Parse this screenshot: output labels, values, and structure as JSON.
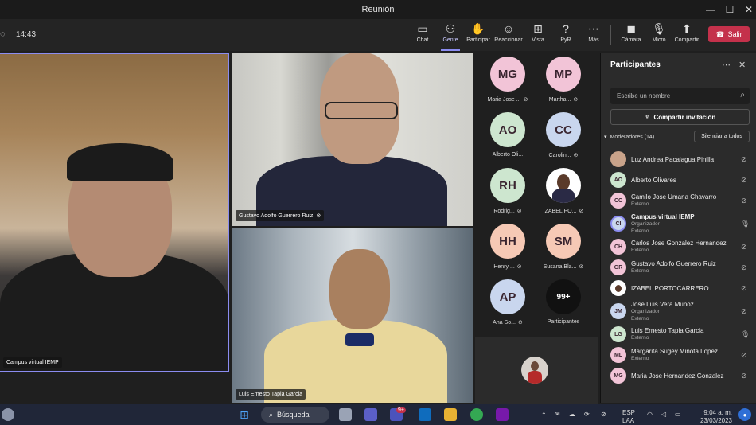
{
  "window": {
    "title": "Reunión",
    "minimize": "—",
    "maximize": "☐",
    "close": "✕"
  },
  "toolbar": {
    "time": "14:43",
    "buttons": [
      {
        "label": "Chat",
        "icon": "chat-icon"
      },
      {
        "label": "Gente",
        "icon": "people-icon"
      },
      {
        "label": "Participar",
        "icon": "hand-icon"
      },
      {
        "label": "Reaccionar",
        "icon": "emoji-icon"
      },
      {
        "label": "Vista",
        "icon": "view-icon"
      },
      {
        "label": "PyR",
        "icon": "qa-icon"
      },
      {
        "label": "Más",
        "icon": "more-icon"
      },
      {
        "label": "Cámara",
        "icon": "camera-off-icon"
      },
      {
        "label": "Micro",
        "icon": "mic-off-icon"
      },
      {
        "label": "Compartir",
        "icon": "share-icon"
      }
    ],
    "leave_label": "Salir"
  },
  "videos": [
    {
      "name": "Campus virtual IEMP"
    },
    {
      "name": "Gustavo Adolfo Guerrero Ruiz"
    },
    {
      "name": "Luis Ernesto Tapia Garcia"
    }
  ],
  "grid": [
    {
      "initials": "MG",
      "name": "Maria Jose ...",
      "color": "#f2c4d7"
    },
    {
      "initials": "MP",
      "name": "Martha...",
      "color": "#f2c4d7"
    },
    {
      "initials": "AO",
      "name": "Alberto Oli...",
      "color": "#cde6cf"
    },
    {
      "initials": "CC",
      "name": "Carolin...",
      "color": "#c9d6ee"
    },
    {
      "initials": "RH",
      "name": "Rodrig...",
      "color": "#cde6cf"
    },
    {
      "initials": "",
      "name": "IZABEL PO...",
      "color": "#ffffff"
    },
    {
      "initials": "HH",
      "name": "Henry ...",
      "color": "#f6c9b5"
    },
    {
      "initials": "SM",
      "name": "Susana Bla...",
      "color": "#f6c9b5"
    },
    {
      "initials": "AP",
      "name": "Ana So...",
      "color": "#c9d6ee"
    },
    {
      "initials": "99+",
      "name": "Participantes",
      "color": "#111111"
    }
  ],
  "panel": {
    "title": "Participantes",
    "search_placeholder": "Escribe un nombre",
    "share_invite": "Compartir invitación",
    "moderators_header": "Moderadores (14)",
    "mute_all": "Silenciar a todos",
    "people": [
      {
        "initials": "",
        "name": "Luz Andrea Pacalagua Pinilla",
        "sub": "",
        "color": "#c9a38a",
        "bold": false,
        "mic": "off"
      },
      {
        "initials": "AO",
        "name": "Alberto Olivares",
        "sub": "",
        "color": "#cde6cf",
        "bold": false,
        "mic": "off"
      },
      {
        "initials": "CC",
        "name": "Camilo Jose Umana Chavarro",
        "sub": "Externo",
        "color": "#f2c4d7",
        "bold": false,
        "mic": "off"
      },
      {
        "initials": "CI",
        "name": "Campus virtual IEMP",
        "sub": "Organizador\nExterno",
        "color": "#c9d6ee",
        "bold": true,
        "mic": "on"
      },
      {
        "initials": "CH",
        "name": "Carlos Jose Gonzalez Hernandez",
        "sub": "Externo",
        "color": "#f2c4d7",
        "bold": false,
        "mic": "off"
      },
      {
        "initials": "GR",
        "name": "Gustavo Adolfo Guerrero Ruiz",
        "sub": "Externo",
        "color": "#f2c4d7",
        "bold": false,
        "mic": "off"
      },
      {
        "initials": "",
        "name": "IZABEL PORTOCARRERO",
        "sub": "",
        "color": "#ffffff",
        "bold": false,
        "mic": "off"
      },
      {
        "initials": "JM",
        "name": "Jose Luis Vera Munoz",
        "sub": "Organizador\nExterno",
        "color": "#c9d6ee",
        "bold": false,
        "mic": "off"
      },
      {
        "initials": "LG",
        "name": "Luis Ernesto Tapia Garcia",
        "sub": "Externo",
        "color": "#cde6cf",
        "bold": false,
        "mic": "on"
      },
      {
        "initials": "ML",
        "name": "Margarita Sugey Minota Lopez",
        "sub": "Externo",
        "color": "#f2c4d7",
        "bold": false,
        "mic": "off"
      },
      {
        "initials": "MG",
        "name": "Maria Jose Hernandez Gonzalez",
        "sub": "",
        "color": "#f2c4d7",
        "bold": false,
        "mic": "off"
      }
    ]
  },
  "taskbar": {
    "search": "Búsqueda",
    "teams_badge": "9+",
    "lang1": "ESP",
    "lang2": "LAA",
    "time": "9:04 a. m.",
    "date": "23/03/2023"
  }
}
